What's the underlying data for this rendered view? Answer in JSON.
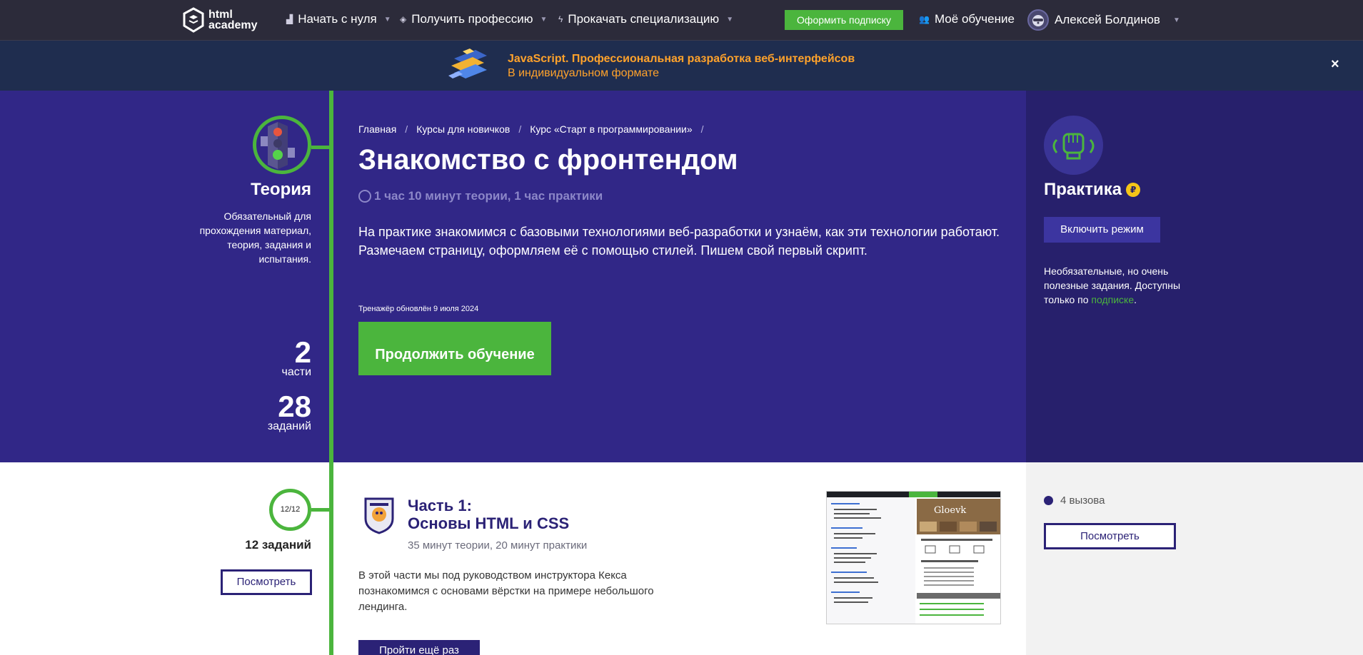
{
  "nav": {
    "logo_line1": "html",
    "logo_line2": "academy",
    "items": [
      {
        "label": "Начать с нуля"
      },
      {
        "label": "Получить профессию"
      },
      {
        "label": "Прокачать специализацию"
      }
    ],
    "subscribe_label": "Оформить подписку",
    "my_learning_label": "Моё обучение",
    "user_name": "Алексей Болдинов"
  },
  "banner": {
    "title": "JavaScript. Профессиональная разработка веб-интерфейсов",
    "subtitle": "В индивидуальном формате",
    "close_label": "×"
  },
  "theory": {
    "title": "Теория",
    "description": "Обязательный для прохождения материал, теория, задания и испытания.",
    "parts_count": "2",
    "parts_label": "части",
    "tasks_count": "28",
    "tasks_label": "заданий"
  },
  "hero": {
    "breadcrumbs": [
      "Главная",
      "Курсы для новичков",
      "Курс «Старт в программировании»"
    ],
    "title": "Знакомство с фронтендом",
    "duration": "1 час 10 минут теории, 1 час практики",
    "description": "На практике знакомимся с базовыми технологиями веб-разработки и узнаём, как эти технологии работают. Размечаем страницу, оформляем её с помощью стилей. Пишем свой первый скрипт.",
    "updated": "Тренажёр обновлён 9 июля 2024",
    "continue_label": "Продолжить обучение"
  },
  "practice": {
    "title": "Практика",
    "coin": "₽",
    "mode_button": "Включить режим",
    "description": "Необязательные, но очень полезные задания. Доступны только по",
    "link_text": "подписке",
    "tail": "."
  },
  "part1": {
    "progress": "12/12",
    "tasks": "12 заданий",
    "view_label": "Посмотреть",
    "title_line1": "Часть 1:",
    "title_line2": "Основы HTML и CSS",
    "duration": "35 минут теории, 20 минут практики",
    "description": "В этой части мы под руководством инструктора Кекса познакомимся с основами вёрстки на примере небольшого лендинга.",
    "retry_label": "Пройти ещё раз",
    "preview_brand": "Gloevk",
    "challenges": "4 вызова",
    "challenges_view_label": "Посмотреть"
  },
  "colors": {
    "accent_green": "#4bb53d",
    "hero_purple": "#312787",
    "banner_orange": "#ffa22b",
    "nav_dark": "#2c2b3a"
  }
}
